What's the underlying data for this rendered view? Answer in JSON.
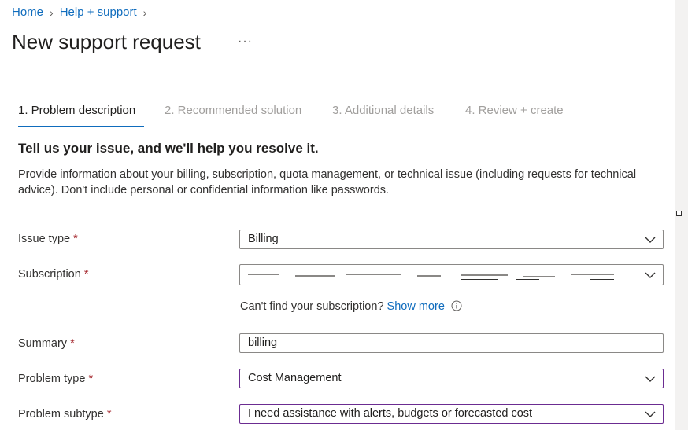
{
  "breadcrumb": {
    "home": "Home",
    "help_support": "Help + support"
  },
  "title": "New support request",
  "more_label": "···",
  "tabs": [
    {
      "label": "1. Problem description",
      "active": true
    },
    {
      "label": "2. Recommended solution",
      "active": false
    },
    {
      "label": "3. Additional details",
      "active": false
    },
    {
      "label": "4. Review + create",
      "active": false
    }
  ],
  "heading": "Tell us your issue, and we'll help you resolve it.",
  "description": "Provide information about your billing, subscription, quota management, or technical issue (including requests for technical advice). Don't include personal or confidential information like passwords.",
  "form": {
    "required_marker": "*",
    "issue_type": {
      "label": "Issue type",
      "value": "Billing"
    },
    "subscription": {
      "label": "Subscription"
    },
    "hint": {
      "text": "Can't find your subscription?",
      "link": "Show more"
    },
    "summary": {
      "label": "Summary",
      "value": "billing"
    },
    "problem_type": {
      "label": "Problem type",
      "value": "Cost Management"
    },
    "problem_subtype": {
      "label": "Problem subtype",
      "value": "I need assistance with alerts, budgets or forecasted cost"
    }
  },
  "colors": {
    "accent": "#0f6cbd",
    "required": "#a4262c",
    "focus_border": "#6b2c91",
    "muted_tab": "#a19f9d"
  },
  "icons": {
    "dropdown": "chevron-down-icon",
    "info": "info-icon",
    "separator": "chevron-right-icon"
  }
}
